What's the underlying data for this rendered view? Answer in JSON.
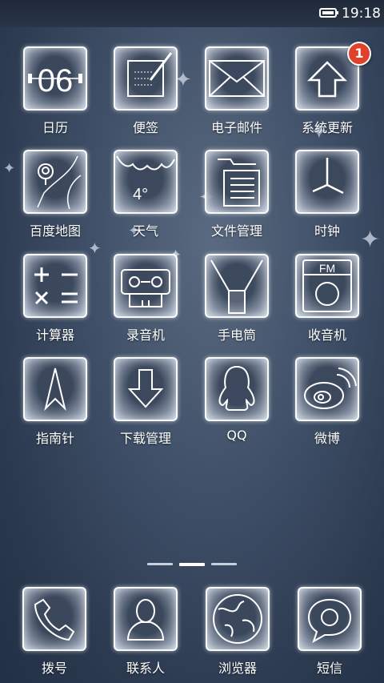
{
  "status_bar": {
    "time": "19:18",
    "battery_level": 0.8,
    "icons": [
      "battery-icon"
    ]
  },
  "colors": {
    "background": "#34445c",
    "badge": "#e0412a",
    "pager_active": "#ffffff",
    "pager_inactive": "#c8d0dc"
  },
  "home": {
    "apps": [
      {
        "label": "日历",
        "icon": "calendar-icon",
        "date_text": "06"
      },
      {
        "label": "便签",
        "icon": "notepad-icon"
      },
      {
        "label": "电子邮件",
        "icon": "mail-icon"
      },
      {
        "label": "系统更新",
        "icon": "update-arrow-icon",
        "badge": "1"
      },
      {
        "label": "百度地图",
        "icon": "map-pin-icon"
      },
      {
        "label": "天气",
        "icon": "cloud-icon",
        "temp_text": "4°"
      },
      {
        "label": "文件管理",
        "icon": "folder-icon"
      },
      {
        "label": "时钟",
        "icon": "clock-icon"
      },
      {
        "label": "计算器",
        "icon": "calculator-icon"
      },
      {
        "label": "录音机",
        "icon": "cassette-icon"
      },
      {
        "label": "手电筒",
        "icon": "flashlight-icon"
      },
      {
        "label": "收音机",
        "icon": "radio-icon",
        "band_text": "FM"
      },
      {
        "label": "指南针",
        "icon": "compass-icon"
      },
      {
        "label": "下载管理",
        "icon": "download-icon"
      },
      {
        "label": "QQ",
        "icon": "qq-penguin-icon"
      },
      {
        "label": "微博",
        "icon": "weibo-icon"
      }
    ],
    "page_indicator": {
      "pages": 3,
      "current": 2
    }
  },
  "dock": {
    "apps": [
      {
        "label": "拨号",
        "icon": "phone-icon"
      },
      {
        "label": "联系人",
        "icon": "contact-icon"
      },
      {
        "label": "浏览器",
        "icon": "globe-icon"
      },
      {
        "label": "短信",
        "icon": "message-bubble-icon"
      }
    ]
  }
}
